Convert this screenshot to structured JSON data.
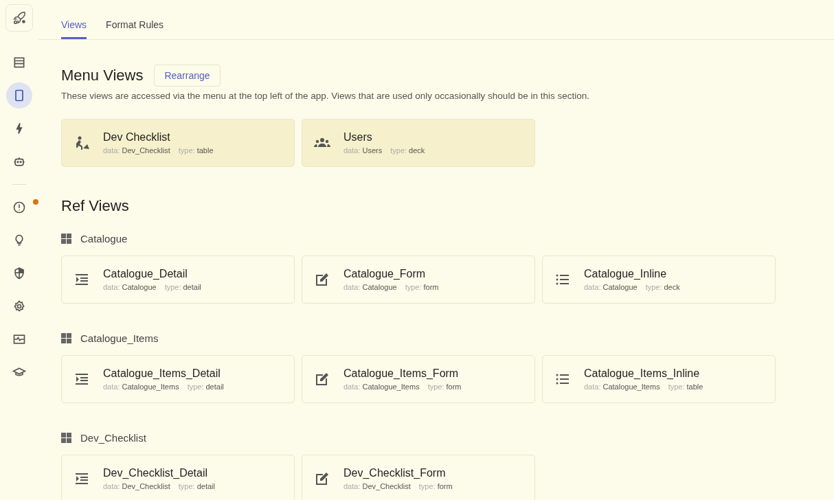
{
  "sidebar": {
    "items": [
      {
        "kind": "table",
        "selected": false,
        "badge": false
      },
      {
        "kind": "phone",
        "selected": true,
        "badge": false
      },
      {
        "kind": "bolt",
        "selected": false,
        "badge": false
      },
      {
        "kind": "robot",
        "selected": false,
        "badge": false
      },
      {
        "kind": "divider"
      },
      {
        "kind": "alert",
        "selected": false,
        "badge": true
      },
      {
        "kind": "bulb",
        "selected": false,
        "badge": false
      },
      {
        "kind": "shield",
        "selected": false,
        "badge": false
      },
      {
        "kind": "gear",
        "selected": false,
        "badge": false
      },
      {
        "kind": "monitor",
        "selected": false,
        "badge": false
      },
      {
        "kind": "cap",
        "selected": false,
        "badge": false
      }
    ]
  },
  "tabs": [
    {
      "label": "Views",
      "selected": true
    },
    {
      "label": "Format Rules",
      "selected": false
    }
  ],
  "menu_views": {
    "title": "Menu Views",
    "button": "Rearrange",
    "description": "These views are accessed via the menu at the top left of the app. Views that are used only occasionally should be in this section.",
    "cards": [
      {
        "kind": "worker",
        "name": "Dev Checklist",
        "data_label": "data:",
        "data": "Dev_Checklist",
        "type_label": "type:",
        "type": "table"
      },
      {
        "kind": "users",
        "name": "Users",
        "data_label": "data:",
        "data": "Users",
        "type_label": "type:",
        "type": "deck"
      }
    ]
  },
  "ref_views": {
    "title": "Ref Views",
    "groups": [
      {
        "name": "Catalogue",
        "cards": [
          {
            "kind": "detail",
            "name": "Catalogue_Detail",
            "data_label": "data:",
            "data": "Catalogue",
            "type_label": "type:",
            "type": "detail"
          },
          {
            "kind": "form",
            "name": "Catalogue_Form",
            "data_label": "data:",
            "data": "Catalogue",
            "type_label": "type:",
            "type": "form"
          },
          {
            "kind": "inline",
            "name": "Catalogue_Inline",
            "data_label": "data:",
            "data": "Catalogue",
            "type_label": "type:",
            "type": "deck"
          }
        ]
      },
      {
        "name": "Catalogue_Items",
        "cards": [
          {
            "kind": "detail",
            "name": "Catalogue_Items_Detail",
            "data_label": "data:",
            "data": "Catalogue_Items",
            "type_label": "type:",
            "type": "detail"
          },
          {
            "kind": "form",
            "name": "Catalogue_Items_Form",
            "data_label": "data:",
            "data": "Catalogue_Items",
            "type_label": "type:",
            "type": "form"
          },
          {
            "kind": "inline",
            "name": "Catalogue_Items_Inline",
            "data_label": "data:",
            "data": "Catalogue_Items",
            "type_label": "type:",
            "type": "table"
          }
        ]
      },
      {
        "name": "Dev_Checklist",
        "cards": [
          {
            "kind": "detail",
            "name": "Dev_Checklist_Detail",
            "data_label": "data:",
            "data": "Dev_Checklist",
            "type_label": "type:",
            "type": "detail"
          },
          {
            "kind": "form",
            "name": "Dev_Checklist_Form",
            "data_label": "data:",
            "data": "Dev_Checklist",
            "type_label": "type:",
            "type": "form"
          }
        ]
      }
    ]
  }
}
